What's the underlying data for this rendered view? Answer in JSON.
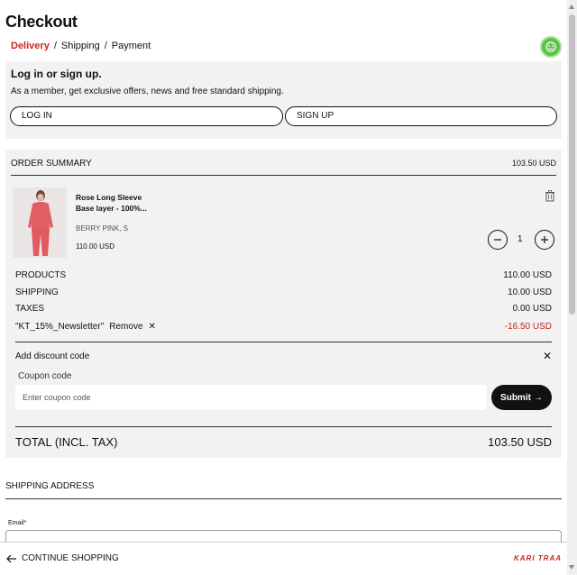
{
  "header": {
    "title": "Checkout",
    "breadcrumbs": [
      "Delivery",
      "Shipping",
      "Payment"
    ]
  },
  "help_icon": "chat-help-icon",
  "login": {
    "title": "Log in or sign up.",
    "description": "As a member, get exclusive offers, news and free standard shipping.",
    "login_label": "LOG IN",
    "signup_label": "SIGN UP"
  },
  "summary": {
    "heading": "ORDER SUMMARY",
    "total_top": "103.50 USD",
    "item": {
      "name": "Rose Long Sleeve Base layer - 100%...",
      "variant": "BERRY PINK, S",
      "price": "110.00 USD",
      "quantity": "1"
    },
    "rows": {
      "products_label": "PRODUCTS",
      "products_value": "110.00 USD",
      "shipping_label": "SHIPPING",
      "shipping_value": "10.00 USD",
      "taxes_label": "TAXES",
      "taxes_value": "0.00 USD",
      "coupon_name": "\"KT_15%_Newsletter\"",
      "coupon_remove": "Remove",
      "coupon_value": "-16.50 USD"
    },
    "discount": {
      "add_label": "Add discount code",
      "coupon_label": "Coupon code",
      "placeholder": "Enter coupon code",
      "submit_label": "Submit"
    },
    "total_label": "TOTAL (INCL. TAX)",
    "total_value": "103.50 USD"
  },
  "shipping": {
    "heading": "SHIPPING ADDRESS",
    "email_label": "Email*"
  },
  "footer": {
    "continue_label": "CONTINUE SHOPPING",
    "brand": "KARI TRAA"
  },
  "colors": {
    "accent": "#d0261b",
    "panel": "#f2f2f2",
    "help_green": "#5cc34a"
  }
}
